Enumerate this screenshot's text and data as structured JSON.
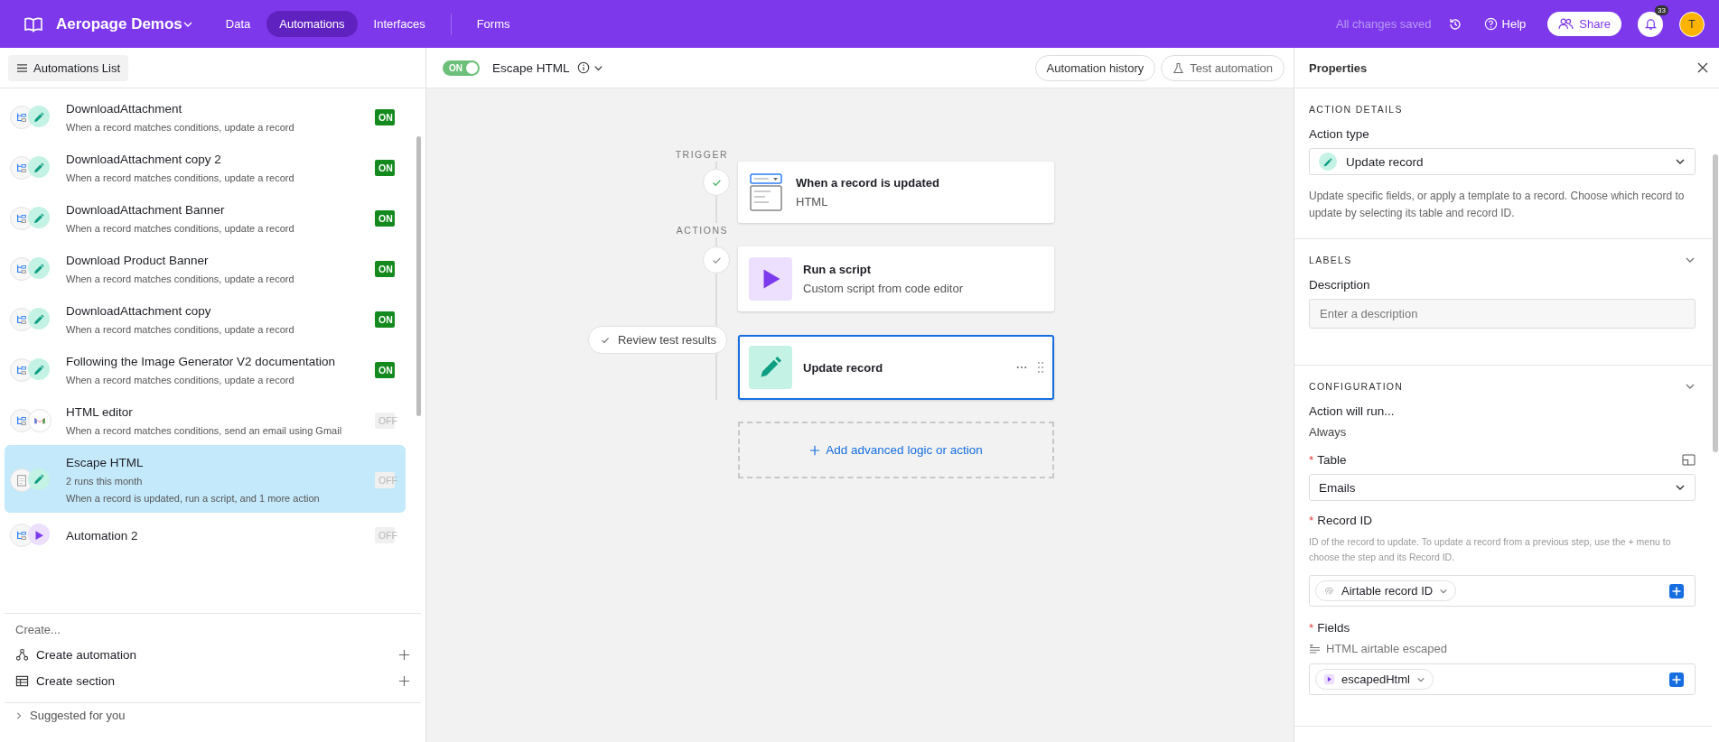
{
  "topbar": {
    "base_name": "Aeropage Demos",
    "nav": [
      {
        "label": "Data",
        "selected": false
      },
      {
        "label": "Automations",
        "selected": true
      },
      {
        "label": "Interfaces",
        "selected": false
      },
      {
        "label": "Forms",
        "selected": false
      }
    ],
    "save_status": "All changes saved",
    "help": "Help",
    "share": "Share",
    "notifications": "33",
    "avatar": "T"
  },
  "sidebar": {
    "header_button": "Automations List",
    "automations": [
      {
        "title": "DownloadAttachment",
        "details": [
          "When a record matches conditions, update a record"
        ],
        "kind": "update",
        "status": "ON",
        "on": true,
        "selected": false
      },
      {
        "title": "DownloadAttachment copy 2",
        "details": [
          "When a record matches conditions, update a record"
        ],
        "kind": "update",
        "status": "ON",
        "on": true,
        "selected": false
      },
      {
        "title": "DownloadAttachment Banner",
        "details": [
          "When a record matches conditions, update a record"
        ],
        "kind": "update",
        "status": "ON",
        "on": true,
        "selected": false
      },
      {
        "title": "Download Product Banner",
        "details": [
          "When a record matches conditions, update a record"
        ],
        "kind": "update",
        "status": "ON",
        "on": true,
        "selected": false
      },
      {
        "title": "DownloadAttachment copy",
        "details": [
          "When a record matches conditions, update a record"
        ],
        "kind": "update",
        "status": "ON",
        "on": true,
        "selected": false
      },
      {
        "title": "Following the Image Generator V2 documentation",
        "details": [
          "When a record matches conditions, update a record"
        ],
        "kind": "update",
        "status": "ON",
        "on": true,
        "selected": false
      },
      {
        "title": "HTML editor",
        "details": [
          "When a record matches conditions, send an email using Gmail"
        ],
        "kind": "gmail",
        "status": "OFF",
        "on": false,
        "selected": false
      },
      {
        "title": "Escape HTML",
        "details": [
          "2 runs this month",
          "When a record is updated, run a script, and 1 more action"
        ],
        "kind": "multi",
        "status": "OFF",
        "on": false,
        "selected": true
      },
      {
        "title": "Automation 2",
        "kind": "script",
        "status": "OFF",
        "on": false,
        "selected": false
      }
    ],
    "create_heading": "Create...",
    "create_items": [
      {
        "kind": "automation",
        "label": "Create automation"
      },
      {
        "kind": "section",
        "label": "Create section"
      }
    ],
    "suggested": "Suggested for you"
  },
  "toolbar": {
    "on": true,
    "toggle_label": "ON",
    "title": "Escape HTML",
    "buttons": [
      {
        "kind": "history",
        "label": "Automation history"
      },
      {
        "kind": "test",
        "label": "Test automation"
      }
    ]
  },
  "canvas": {
    "trigger_heading": "TRIGGER",
    "actions_heading": "ACTIONS",
    "steps": [
      {
        "kind": "trigger",
        "title": "When a record is updated",
        "subtitle": "HTML",
        "passed": true,
        "selected": false
      },
      {
        "kind": "script",
        "title": "Run a script",
        "subtitle": "Custom script from code editor",
        "passed": false,
        "selected": false
      },
      {
        "kind": "update",
        "title": "Update record",
        "selected": true
      }
    ],
    "review_button": "Review test results",
    "add_button": "Add advanced logic or action"
  },
  "properties": {
    "title": "Properties",
    "sections": [
      {
        "heading": "ACTION DETAILS",
        "collapsible": false,
        "items": [
          {
            "kind": "label",
            "text": "Action type"
          },
          {
            "kind": "action_select",
            "value": "Update record"
          },
          {
            "kind": "help",
            "text": "Update specific fields, or apply a template to a record. Choose which record to update by selecting its table and record ID."
          }
        ]
      },
      {
        "heading": "LABELS",
        "collapsible": true,
        "items": [
          {
            "kind": "label",
            "text": "Description"
          },
          {
            "kind": "input",
            "placeholder": "Enter a description"
          }
        ]
      },
      {
        "heading": "CONFIGURATION",
        "collapsible": true,
        "items": [
          {
            "kind": "label",
            "text": "Action will run..."
          },
          {
            "kind": "text",
            "text": "Always"
          },
          {
            "kind": "label",
            "required_mark": "*",
            "text": "Table",
            "expand_button": true
          },
          {
            "kind": "select",
            "value": "Emails"
          },
          {
            "kind": "label",
            "required_mark": "*",
            "text": "Record ID"
          },
          {
            "kind": "hint",
            "text": "ID of the record to update. To update a record from a previous step, use the + menu to choose the step and its Record ID."
          },
          {
            "kind": "record_token",
            "token": "Airtable record ID"
          },
          {
            "kind": "label",
            "required_mark": "*",
            "text": "Fields"
          },
          {
            "kind": "field_name",
            "text": "HTML airtable escaped"
          },
          {
            "kind": "script_token",
            "token": "escapedHtml"
          }
        ]
      }
    ]
  }
}
